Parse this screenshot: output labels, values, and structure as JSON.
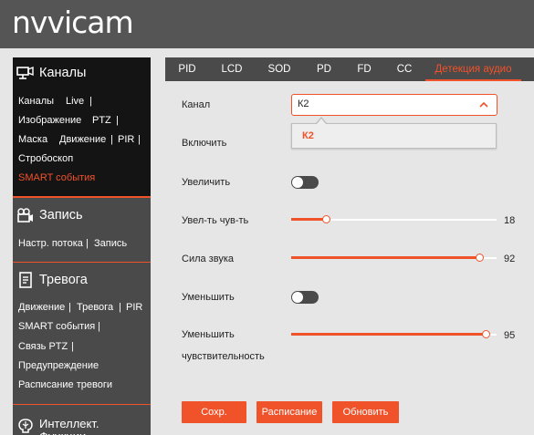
{
  "logo": "nᴠvicam",
  "sidebar": {
    "channels": {
      "title": "Каналы",
      "row1": [
        "Каналы",
        "Live"
      ],
      "row2": [
        "Изображение",
        "PTZ"
      ],
      "row3": [
        "Маска",
        "Движение",
        "PIR"
      ],
      "row4": [
        "Стробоскоп"
      ],
      "row5": [
        "SMART события"
      ]
    },
    "record": {
      "title": "Запись",
      "row1": [
        "Настр. потока",
        "Запись"
      ]
    },
    "alarm": {
      "title": "Тревога",
      "row1": [
        "Движение",
        "Тревога",
        "PIR"
      ],
      "row2": [
        "SMART события"
      ],
      "row3": [
        "Связь PTZ"
      ],
      "row4": [
        "Предупреждение"
      ],
      "row5": [
        "Расписание тревоги"
      ]
    },
    "intel": {
      "title": "Интеллект. Функции"
    },
    "separator": "|"
  },
  "tabs": [
    "PID",
    "LCD",
    "SOD",
    "PD",
    "FD",
    "CC",
    "Детекция аудио"
  ],
  "form": {
    "channel_label": "Канал",
    "channel_value": "К2",
    "channel_option": "К2",
    "enable_label": "Включить",
    "increase_label": "Увеличить",
    "increase_on": false,
    "inc_sens_label": "Увел-ть чув-ть",
    "inc_sens_value": "18",
    "volume_label": "Сила звука",
    "volume_value": "92",
    "decrease_label": "Уменьшить",
    "decrease_on": false,
    "dec_sens_label_1": "Уменьшить",
    "dec_sens_label_2": "чувствительность",
    "dec_sens_value": "95"
  },
  "buttons": {
    "save": "Сохр.",
    "schedule": "Расписание",
    "refresh": "Обновить"
  },
  "colors": {
    "accent": "#f0522a",
    "header": "#555555",
    "sidebar": "#4a4a4a",
    "sidebar_active": "#141414"
  },
  "icons": {
    "channels": "monitor-camera-icon",
    "record": "video-camera-icon",
    "alarm": "document-alarm-icon",
    "intel": "brain-icon",
    "select": "chevron-up-icon"
  }
}
